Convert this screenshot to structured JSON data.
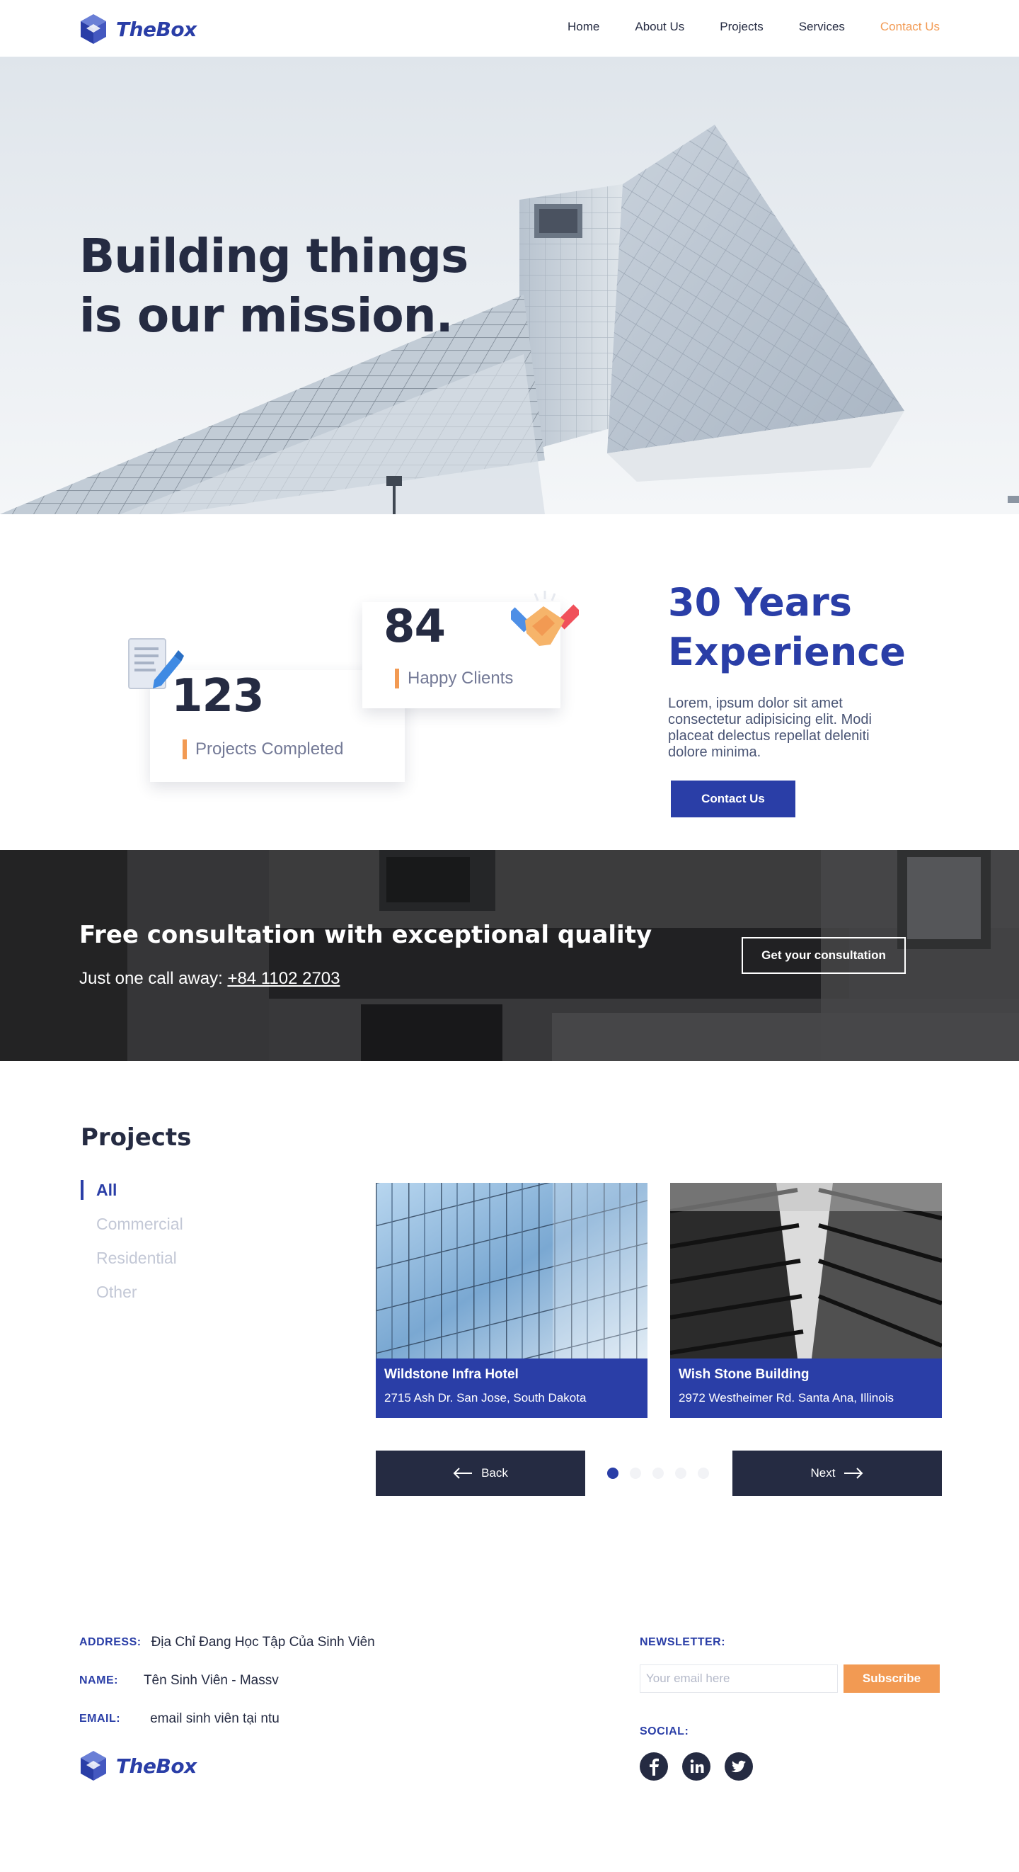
{
  "brand": {
    "name": "TheBox",
    "color": "#2a3ea7",
    "accent": "#f29a53",
    "dark": "#252b42"
  },
  "nav": {
    "items": [
      {
        "label": "Home",
        "active": false
      },
      {
        "label": "About Us",
        "active": false
      },
      {
        "label": "Projects",
        "active": false
      },
      {
        "label": "Services",
        "active": false
      },
      {
        "label": "Contact Us",
        "active": true
      }
    ]
  },
  "hero": {
    "title_line1": "Building things",
    "title_line2": "is our mission."
  },
  "stats": {
    "projects": {
      "value": "123",
      "label": "Projects Completed",
      "icon": "document-pen-icon"
    },
    "clients": {
      "value": "84",
      "label": "Happy Clients",
      "icon": "handshake-icon"
    },
    "experience_title_line1": "30 Years",
    "experience_title_line2": "Experience",
    "experience_text": "Lorem, ipsum dolor sit amet consectetur adipisicing elit. Modi placeat delectus repellat deleniti dolore minima.",
    "contact_button": "Contact Us"
  },
  "consult": {
    "title": "Free consultation with exceptional quality",
    "subtitle_prefix": "Just one call away: ",
    "phone": "+84 1102 2703",
    "button": "Get your consultation"
  },
  "projects": {
    "title": "Projects",
    "filters": [
      {
        "label": "All",
        "active": true
      },
      {
        "label": "Commercial",
        "active": false
      },
      {
        "label": "Residential",
        "active": false
      },
      {
        "label": "Other",
        "active": false
      }
    ],
    "cards": [
      {
        "name": "Wildstone Infra Hotel",
        "address": "2715 Ash Dr. San Jose, South Dakota"
      },
      {
        "name": "Wish Stone Building",
        "address": "2972 Westheimer Rd. Santa Ana, Illinois"
      }
    ],
    "back_label": "Back",
    "next_label": "Next",
    "pagination": {
      "total": 5,
      "current": 1
    }
  },
  "footer": {
    "address_key": "ADDRESS:",
    "address_val": "Địa Chỉ Đang Học Tập Của Sinh Viên",
    "name_key": "NAME:",
    "name_val": "Tên Sinh Viên - Massv",
    "email_key": "EMAIL:",
    "email_val": "email sinh viên tại ntu",
    "newsletter_title": "NEWSLETTER:",
    "newsletter_placeholder": "Your email here",
    "subscribe": "Subscribe",
    "social_title": "SOCIAL:",
    "socials": [
      "facebook-icon",
      "linkedin-icon",
      "twitter-icon"
    ]
  }
}
